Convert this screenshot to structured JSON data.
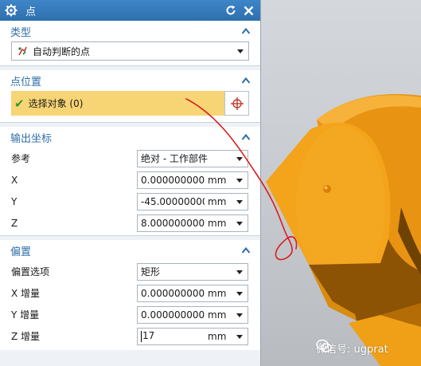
{
  "titlebar": {
    "title": "点",
    "icons": [
      "gear-icon",
      "reset-icon",
      "close-icon"
    ]
  },
  "groups": {
    "type": {
      "header": "类型",
      "select_value": "自动判断的点",
      "icon": "inferred-point-icon"
    },
    "point_location": {
      "header": "点位置",
      "select_object_label": "选择对象 (0)",
      "button_icon": "point-crosshair-icon"
    },
    "output_coords": {
      "header": "输出坐标",
      "reference_label": "参考",
      "reference_value": "绝对 - 工作部件",
      "x_label": "X",
      "x_value": "0.0000000000",
      "x_unit": "mm",
      "y_label": "Y",
      "y_value": "-45.0000000000",
      "y_unit": "mm",
      "z_label": "Z",
      "z_value": "8.0000000000",
      "z_unit": "mm"
    },
    "offset": {
      "header": "偏置",
      "option_label": "偏置选项",
      "option_value": "矩形",
      "x_inc_label": "X 增量",
      "x_inc_value": "0.0000000000",
      "x_inc_unit": "mm",
      "y_inc_label": "Y 增量",
      "y_inc_value": "0.0000000000",
      "y_inc_unit": "mm",
      "z_inc_label": "Z 增量",
      "z_inc_value": "17",
      "z_inc_unit": "mm"
    }
  },
  "watermark": {
    "text": "微信号: ugprat"
  },
  "colors": {
    "titlebar": "#2e6fad",
    "group_header_text": "#2f6ea8",
    "selection_highlight": "#f7d575",
    "model_orange": "#f0a016",
    "annotation_red": "#d81e1e"
  }
}
